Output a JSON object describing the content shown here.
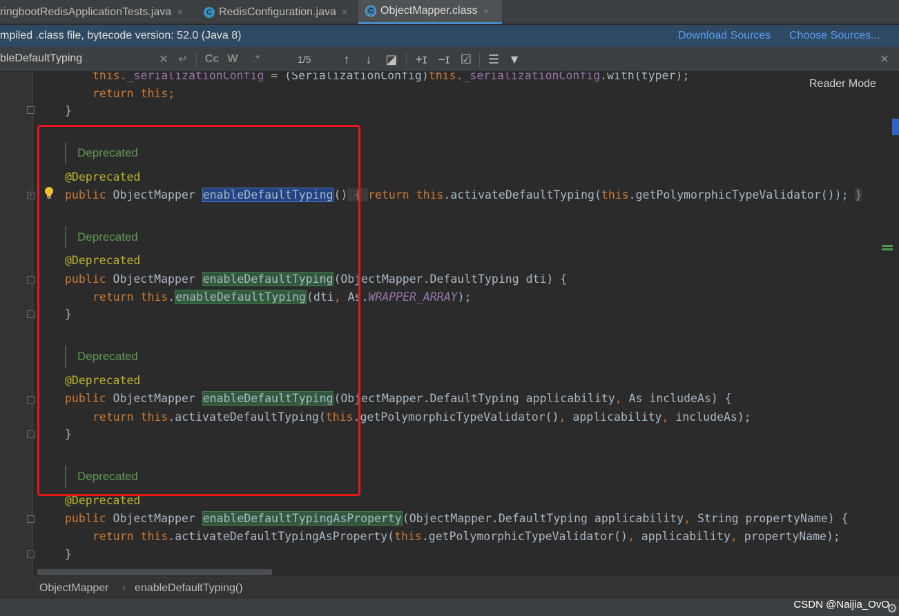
{
  "tabs": [
    {
      "label": "ringbootRedisApplicationTests.java",
      "icon": "class-icon",
      "active": false
    },
    {
      "label": "RedisConfiguration.java",
      "icon": "class-icon",
      "active": false
    },
    {
      "label": "ObjectMapper.class",
      "icon": "locked-class-icon",
      "active": true
    }
  ],
  "tab_close_glyph": "×",
  "banner": {
    "text": "mpiled .class file, bytecode version: 52.0 (Java 8)",
    "download_sources": "Download Sources",
    "choose_sources": "Choose Sources..."
  },
  "search": {
    "query": "bleDefaultTyping",
    "match_count": "1/5",
    "match_case": "Cc",
    "words": "W",
    "regex": ".*"
  },
  "editor": {
    "reader_mode": "Reader Mode",
    "deprecated_doc": "Deprecated",
    "annotation": "@Deprecated",
    "code": {
      "l1_a": "this.",
      "l1_b": "_serializationConfig",
      "l1_c": " = (SerializationConfig)",
      "l1_d": "this.",
      "l1_e": "_serializationConfig",
      "l1_f": ".with(typer);",
      "kw_return": "return",
      "kw_this": "this",
      "kw_public": "public",
      "semicolon": ";",
      "close_brace": "}",
      "type_object_mapper": " ObjectMapper ",
      "method_enable": "enableDefaultTyping",
      "method_enable_prop": "enableDefaultTypingAsProperty",
      "m1_sig": "()",
      "m1_fold": " { ",
      "m1_body_a": " ",
      "m1_body_b": ".activateDefaultTyping(",
      "m1_body_c": ".getPolymorphicTypeValidator());",
      "m2_params": "(ObjectMapper.DefaultTyping dti) {",
      "m2_body_a": "dti",
      "m2_body_b": ", As.",
      "m2_body_c": "WRAPPER_ARRAY",
      "m2_body_d": ");",
      "m3_params_a": "(ObjectMapper.DefaultTyping applicability",
      "m3_params_b": ", ",
      "m3_params_c": "As includeAs) {",
      "m3_body_b": ".activateDefaultTyping(",
      "m3_body_c": ".getPolymorphicTypeValidator()",
      "m3_body_d": "applicability",
      "m3_body_e": "includeAs);",
      "m4_params_a": "(ObjectMapper.DefaultTyping applicability",
      "m4_params_c": "String propertyName) {",
      "m4_body_b": ".activateDefaultTypingAsProperty(",
      "m4_body_e": "propertyName);"
    }
  },
  "breadcrumb": [
    "ObjectMapper",
    "enableDefaultTyping()"
  ],
  "breadcrumb_separator": "›",
  "watermark": "CSDN @Naijia_OvO",
  "colors": {
    "accent_blue": "#589df6",
    "highlight_red": "#e5191a",
    "doc_green": "#629755",
    "keyword_orange": "#cc7832"
  }
}
